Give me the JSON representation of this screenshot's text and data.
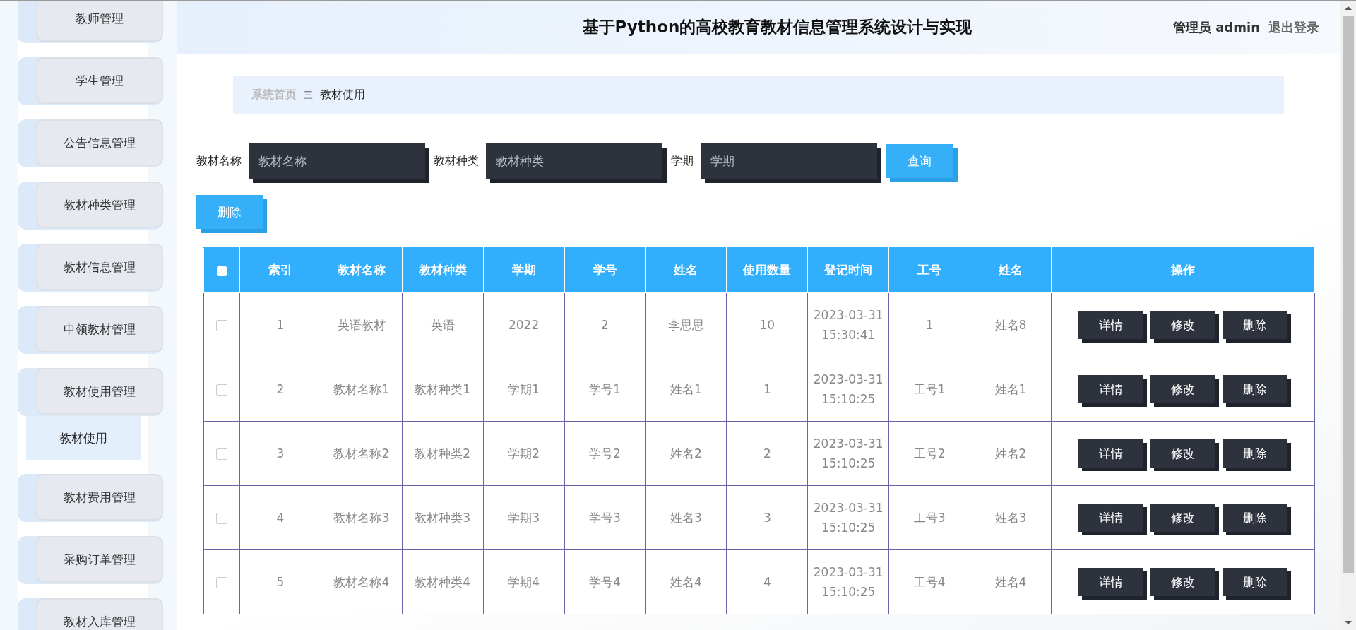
{
  "sidebar": {
    "items": [
      {
        "label": "教师管理"
      },
      {
        "label": "学生管理"
      },
      {
        "label": "公告信息管理"
      },
      {
        "label": "教材种类管理"
      },
      {
        "label": "教材信息管理"
      },
      {
        "label": "申领教材管理"
      },
      {
        "label": "教材使用管理",
        "children": [
          {
            "label": "教材使用",
            "selected": true
          }
        ]
      },
      {
        "label": "教材费用管理"
      },
      {
        "label": "采购订单管理"
      },
      {
        "label": "教材入库管理"
      }
    ]
  },
  "header": {
    "title": "基于Python的高校教育教材信息管理系统设计与实现",
    "user": "管理员 admin",
    "logout": "退出登录"
  },
  "breadcrumb": {
    "home": "系统首页",
    "separator": "三",
    "current": "教材使用"
  },
  "search": {
    "fields": [
      {
        "label": "教材名称",
        "placeholder": "教材名称"
      },
      {
        "label": "教材种类",
        "placeholder": "教材种类"
      },
      {
        "label": "学期",
        "placeholder": "学期"
      }
    ],
    "button": "查询"
  },
  "delete_button": "删除",
  "table": {
    "select_all_checked": false,
    "columns": [
      "索引",
      "教材名称",
      "教材种类",
      "学期",
      "学号",
      "姓名",
      "使用数量",
      "登记时间",
      "工号",
      "姓名",
      "操作"
    ],
    "rows": [
      {
        "checked": false,
        "cells": [
          "1",
          "英语教材",
          "英语",
          "2022",
          "2",
          "李思思",
          "10",
          "2023-03-31 15:30:41",
          "1",
          "姓名8"
        ],
        "actions": [
          "详情",
          "修改",
          "删除"
        ]
      },
      {
        "checked": false,
        "cells": [
          "2",
          "教材名称1",
          "教材种类1",
          "学期1",
          "学号1",
          "姓名1",
          "1",
          "2023-03-31 15:10:25",
          "工号1",
          "姓名1"
        ],
        "actions": [
          "详情",
          "修改",
          "删除"
        ]
      },
      {
        "checked": false,
        "cells": [
          "3",
          "教材名称2",
          "教材种类2",
          "学期2",
          "学号2",
          "姓名2",
          "2",
          "2023-03-31 15:10:25",
          "工号2",
          "姓名2"
        ],
        "actions": [
          "详情",
          "修改",
          "删除"
        ]
      },
      {
        "checked": false,
        "cells": [
          "4",
          "教材名称3",
          "教材种类3",
          "学期3",
          "学号3",
          "姓名3",
          "3",
          "2023-03-31 15:10:25",
          "工号3",
          "姓名3"
        ],
        "actions": [
          "详情",
          "修改",
          "删除"
        ]
      },
      {
        "checked": false,
        "cells": [
          "5",
          "教材名称4",
          "教材种类4",
          "学期4",
          "学号4",
          "姓名4",
          "4",
          "2023-03-31 15:10:25",
          "工号4",
          "姓名4"
        ],
        "actions": [
          "详情",
          "修改",
          "删除"
        ]
      }
    ]
  }
}
